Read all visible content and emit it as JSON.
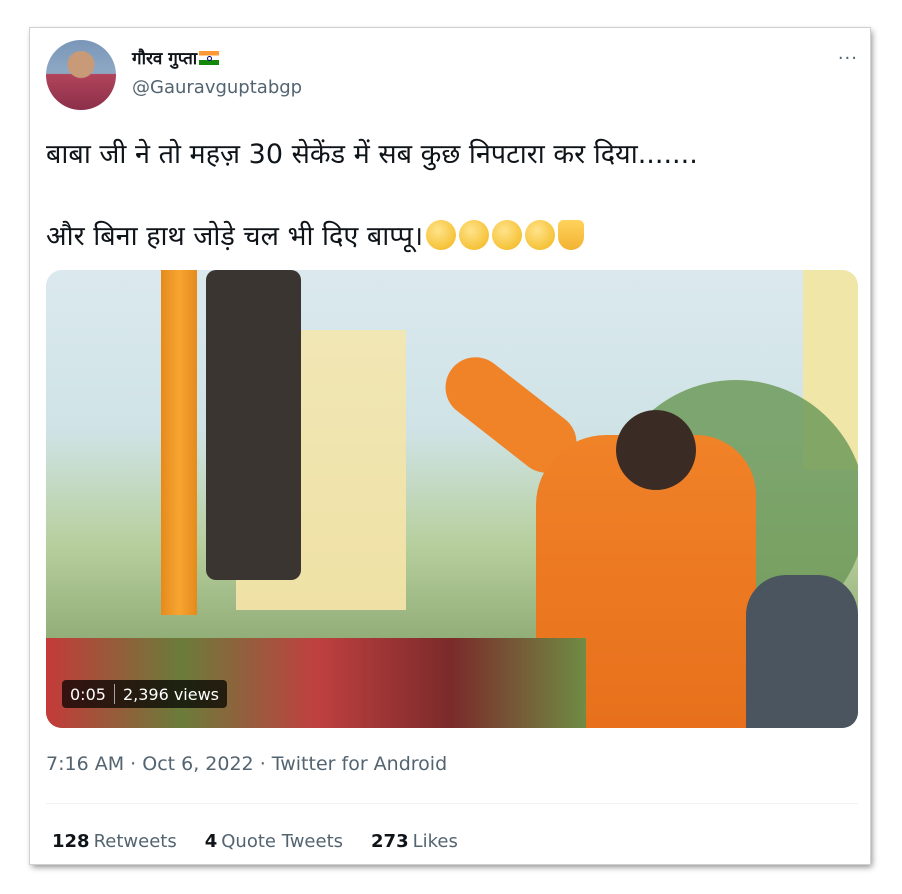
{
  "user": {
    "display_name": "गौरव गुप्ता",
    "handle": "@Gauravguptabgp",
    "flag_icon": "india-flag-icon"
  },
  "tweet": {
    "line1": "बाबा जी ने तो महज़ 30 सेकेंड में सब कुछ निपटारा कर दिया.......",
    "line2": "और बिना हाथ जोड़े चल भी दिए बाप्पू।",
    "emojis": [
      "squinting-tongue-face",
      "rolling-laughing-face",
      "thinking-face",
      "thinking-face",
      "thumbs-down"
    ]
  },
  "video": {
    "duration": "0:05",
    "views": "2,396 views"
  },
  "meta": {
    "time": "7:16 AM",
    "date": "Oct 6, 2022",
    "source": "Twitter for Android"
  },
  "stats": {
    "retweets_count": "128",
    "retweets_label": "Retweets",
    "quotes_count": "4",
    "quotes_label": "Quote Tweets",
    "likes_count": "273",
    "likes_label": "Likes"
  },
  "more_label": "···"
}
